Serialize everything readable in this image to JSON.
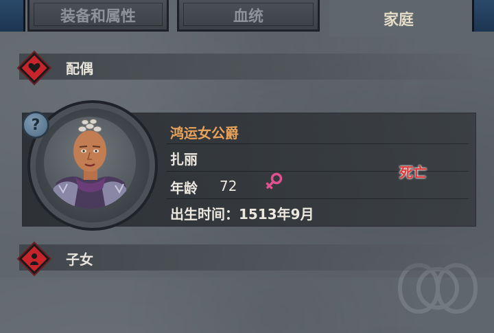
{
  "tabs": [
    {
      "label": "装备和属性",
      "active": false
    },
    {
      "label": "血统",
      "active": false
    },
    {
      "label": "家庭",
      "active": true
    }
  ],
  "sections": {
    "spouse": {
      "title": "配偶",
      "icon": "heart-icon"
    },
    "children": {
      "title": "子女",
      "icon": "child-icon"
    }
  },
  "spouse": {
    "title": "鸿运女公爵",
    "name": "扎丽",
    "age_label": "年龄",
    "age": "72",
    "gender_icon": "female-icon",
    "birth_label": "出生时间：1513年9月",
    "status": "死亡",
    "help_icon": "question-icon"
  },
  "colors": {
    "accent_title": "#e8a25a",
    "status_dead": "#e23a3a",
    "badge_red": "#c8242b",
    "female_pink": "#e0518f"
  }
}
